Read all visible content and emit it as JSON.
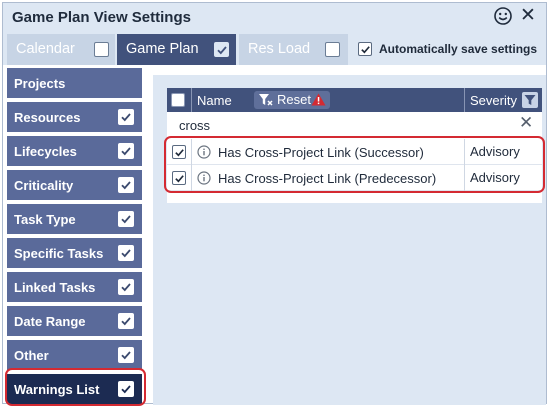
{
  "window": {
    "title": "Game Plan View Settings"
  },
  "tabs": [
    {
      "label": "Calendar",
      "checked": false,
      "active": false
    },
    {
      "label": "Game Plan",
      "checked": true,
      "active": true
    },
    {
      "label": "Res Load",
      "checked": false,
      "active": false
    }
  ],
  "autosave": {
    "label": "Automatically save settings",
    "checked": true
  },
  "sidebar": {
    "items": [
      {
        "label": "Projects",
        "checked": null,
        "selected": false
      },
      {
        "label": "Resources",
        "checked": true,
        "selected": false
      },
      {
        "label": "Lifecycles",
        "checked": true,
        "selected": false
      },
      {
        "label": "Criticality",
        "checked": true,
        "selected": false
      },
      {
        "label": "Task Type",
        "checked": true,
        "selected": false
      },
      {
        "label": "Specific Tasks",
        "checked": true,
        "selected": false
      },
      {
        "label": "Linked Tasks",
        "checked": true,
        "selected": false
      },
      {
        "label": "Date Range",
        "checked": true,
        "selected": false
      },
      {
        "label": "Other",
        "checked": true,
        "selected": false
      },
      {
        "label": "Warnings List",
        "checked": true,
        "selected": true
      }
    ]
  },
  "grid": {
    "header": {
      "name": "Name",
      "reset": "Reset",
      "severity": "Severity"
    },
    "search": {
      "value": "cross"
    },
    "rows": [
      {
        "checked": true,
        "name": "Has Cross-Project Link (Successor)",
        "severity": "Advisory"
      },
      {
        "checked": true,
        "name": "Has Cross-Project Link (Predecessor)",
        "severity": "Advisory"
      }
    ]
  },
  "colors": {
    "title_bar": "#dde7f3",
    "tab_active": "#41527c",
    "tab_inactive": "#c7d4e5",
    "sidebar_item": "#5a6a9a",
    "sidebar_selected": "#1c2b52",
    "highlight_outline": "#d42a32",
    "grid_header": "#41527c",
    "warning": "#d42a32"
  }
}
